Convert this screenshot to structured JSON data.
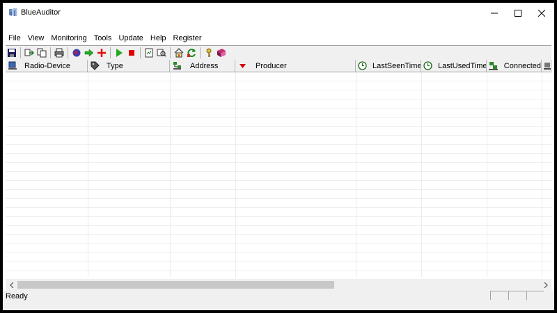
{
  "window": {
    "title": "BlueAuditor",
    "controls": {
      "minimize": "—",
      "maximize": "☐",
      "close": "✕"
    }
  },
  "menu": [
    "File",
    "View",
    "Monitoring",
    "Tools",
    "Update",
    "Help",
    "Register"
  ],
  "toolbar": {
    "buttons": [
      "save-icon",
      "copy-icon",
      "paste-icon",
      "print-icon",
      "globe-icon",
      "arrow-right-icon",
      "add-icon",
      "play-icon",
      "stop-icon",
      "report-icon",
      "search-icon",
      "home-icon",
      "refresh-icon",
      "key-icon",
      "book-icon"
    ]
  },
  "columns": [
    {
      "label": "Radio-Device",
      "icon": "device-icon"
    },
    {
      "label": "Type",
      "icon": "tag-icon"
    },
    {
      "label": "Address",
      "icon": "network-icon"
    },
    {
      "label": "Producer",
      "icon": "sort-desc-icon"
    },
    {
      "label": "LastSeenTime",
      "icon": "clock-icon"
    },
    {
      "label": "LastUsedTime",
      "icon": "clock-icon"
    },
    {
      "label": "Connected",
      "icon": "connection-icon"
    }
  ],
  "status": {
    "text": "Ready"
  },
  "colors": {
    "sort_arrow": "#cc0000",
    "stop": "#dd0000",
    "play": "#22aa22"
  }
}
